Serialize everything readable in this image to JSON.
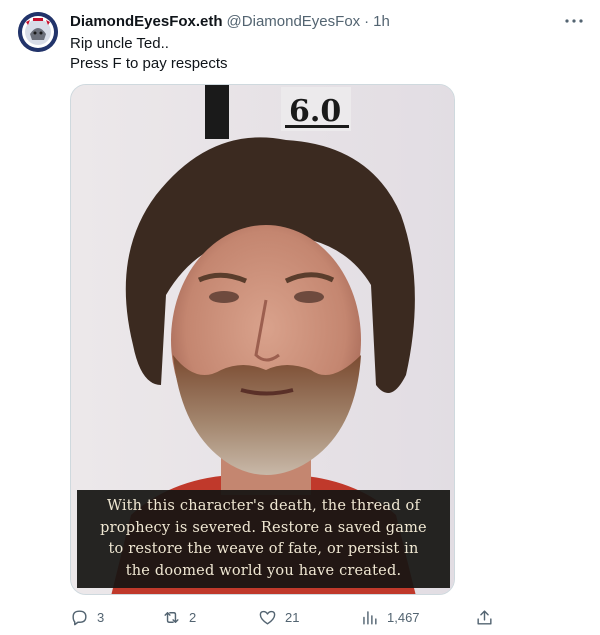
{
  "tweet": {
    "author_name": "DiamondEyesFox.eth",
    "author_handle": "@DiamondEyesFox",
    "separator": "·",
    "time": "1h",
    "text_lines": [
      "Rip uncle Ted..",
      "Press F to pay respects"
    ]
  },
  "media": {
    "placard_text": "6.0",
    "caption_lines": [
      "With this character's death, the thread of",
      "prophecy is severed. Restore a saved game",
      "to restore the weave of fate, or persist in",
      "the doomed world you have created."
    ]
  },
  "actions": {
    "replies": "3",
    "retweets": "2",
    "likes": "21",
    "views": "1,467"
  },
  "icons": {
    "more": "more-icon",
    "reply": "reply-icon",
    "retweet": "retweet-icon",
    "like": "heart-icon",
    "views": "views-icon",
    "share": "share-icon"
  },
  "colors": {
    "text_primary": "#0f1419",
    "text_secondary": "#536471",
    "border": "#cfd9de"
  }
}
